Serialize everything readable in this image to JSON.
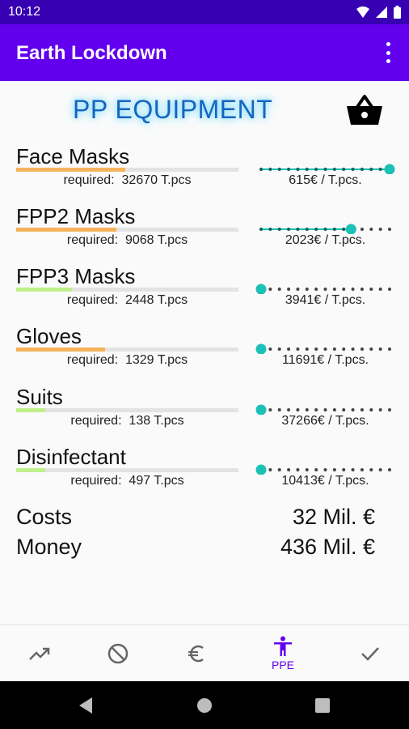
{
  "status_bar": {
    "time": "10:12"
  },
  "app_bar": {
    "title": "Earth Lockdown"
  },
  "page": {
    "heading": "PP EQUIPMENT"
  },
  "colors": {
    "accent": "#6200ee",
    "slider": "#1ac1b4",
    "bar_orange": "#f4b35a",
    "bar_green": "#bff08a"
  },
  "items": [
    {
      "name": "Face Masks",
      "required_label": "required:",
      "required_value": "32670 T.pcs",
      "price": "615€ / T.pcs.",
      "required_fraction": 0.49,
      "bar_color": "#f4b35a",
      "slider_fraction": 1.0
    },
    {
      "name": "FPP2 Masks",
      "required_label": "required:",
      "required_value": "9068 T.pcs",
      "price": "2023€ / T.pcs.",
      "required_fraction": 0.45,
      "bar_color": "#f4b35a",
      "slider_fraction": 0.7
    },
    {
      "name": "FPP3 Masks",
      "required_label": "required:",
      "required_value": "2448 T.pcs",
      "price": "3941€ / T.pcs.",
      "required_fraction": 0.25,
      "bar_color": "#bff08a",
      "slider_fraction": 0.0
    },
    {
      "name": "Gloves",
      "required_label": "required:",
      "required_value": "1329 T.pcs",
      "price": "11691€ / T.pcs.",
      "required_fraction": 0.4,
      "bar_color": "#f4b35a",
      "slider_fraction": 0.0
    },
    {
      "name": "Suits",
      "required_label": "required:",
      "required_value": "138 T.pcs",
      "price": "37266€ / T.pcs.",
      "required_fraction": 0.13,
      "bar_color": "#bff08a",
      "slider_fraction": 0.0
    },
    {
      "name": "Disinfectant",
      "required_label": "required:",
      "required_value": "497 T.pcs",
      "price": "10413€ / T.pcs.",
      "required_fraction": 0.13,
      "bar_color": "#bff08a",
      "slider_fraction": 0.0
    }
  ],
  "summary": {
    "costs_label": "Costs",
    "costs_value": "32 Mil. €",
    "money_label": "Money",
    "money_value": "436 Mil. €"
  },
  "bottom_nav": {
    "items": [
      {
        "icon": "trending-up-icon"
      },
      {
        "icon": "block-icon"
      },
      {
        "icon": "euro-icon"
      },
      {
        "icon": "accessibility-icon",
        "label": "PPE",
        "active": true
      },
      {
        "icon": "check-icon"
      }
    ]
  }
}
